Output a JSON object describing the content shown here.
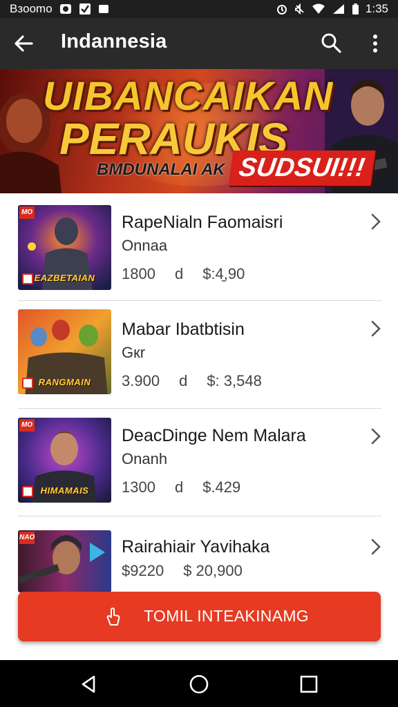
{
  "status_bar": {
    "carrier": "Bзoomo",
    "time": "1:35"
  },
  "app_bar": {
    "title": "Indannesia"
  },
  "banner": {
    "headline_top": "UIBANCAIKAN",
    "headline_main": "PERAUKIS",
    "subtitle": "BMDUNALAI AK",
    "badge": "SUDSUI!!!"
  },
  "items": [
    {
      "name": "RapeNialn Faomaisri",
      "subtitle": "Onnaa",
      "stat_a": "1800",
      "stat_b": "d",
      "stat_c": "$:4̱,90",
      "thumb_caption": "EAZBETAIAN",
      "thumb_tag": "MO"
    },
    {
      "name": "Mabar Ibatbtisin",
      "subtitle": "Gкr",
      "stat_a": "3.900",
      "stat_b": "d",
      "stat_c": "$: 3,548",
      "thumb_caption": "RANGMAIN",
      "thumb_tag": ""
    },
    {
      "name": "DeacDinge Nem Malara",
      "subtitle": "Onanh",
      "stat_a": "1300",
      "stat_b": "d",
      "stat_c": "$.429",
      "thumb_caption": "HIMAMAIS",
      "thumb_tag": "MO"
    },
    {
      "name": "Rairahiair Yavihaka",
      "subtitle": "",
      "stat_a": "$9220",
      "stat_b": "",
      "stat_c": "$ 20,900",
      "thumb_caption": "",
      "thumb_tag": "NAO"
    }
  ],
  "cta": {
    "label": "TOMIL INTEAKINAMG"
  },
  "colors": {
    "accent": "#e63a23",
    "app_bar": "#2a2a2a",
    "status_bar": "#1f1f1f"
  }
}
